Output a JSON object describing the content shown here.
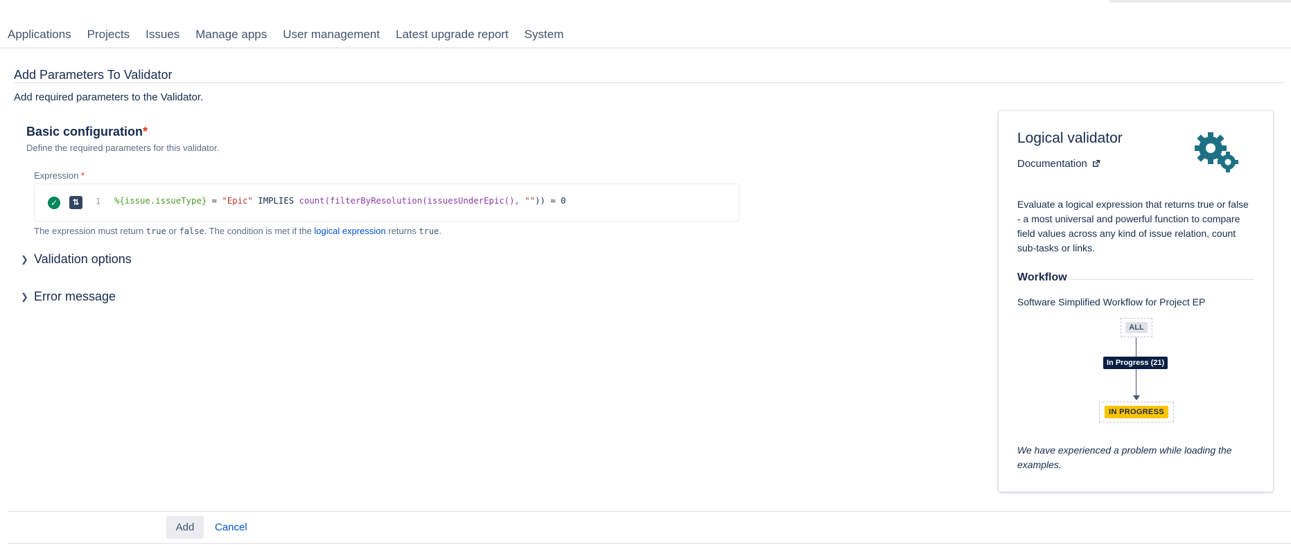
{
  "nav": {
    "items": [
      "Applications",
      "Projects",
      "Issues",
      "Manage apps",
      "User management",
      "Latest upgrade report",
      "System"
    ]
  },
  "page": {
    "title": "Add Parameters To Validator",
    "description": "Add required parameters to the Validator."
  },
  "basic": {
    "title": "Basic configuration",
    "required_mark": "*",
    "description": "Define the required parameters for this validator.",
    "expression_label": "Expression",
    "line_number": "1",
    "code_parts": [
      {
        "text": "%{issue.issueType}",
        "kind": "field"
      },
      {
        "text": " = ",
        "kind": "kw"
      },
      {
        "text": "\"Epic\"",
        "kind": "str"
      },
      {
        "text": " IMPLIES ",
        "kind": "kw"
      },
      {
        "text": "count(filterByResolution(issuesUnderEpic(), ",
        "kind": "fn"
      },
      {
        "text": "\"\"",
        "kind": "str"
      },
      {
        "text": ")) = 0",
        "kind": "kw"
      }
    ],
    "hint": {
      "p1": "The expression must return ",
      "code1": "true",
      "p2": " or ",
      "code2": "false",
      "p3": ". The condition is met if the ",
      "link": "logical expression",
      "p4": " returns ",
      "code3": "true",
      "p5": "."
    }
  },
  "collapsibles": {
    "validation": "Validation options",
    "error": "Error message"
  },
  "card": {
    "title": "Logical validator",
    "doc_link": "Documentation",
    "description": "Evaluate a logical expression that returns true or false - a most universal and powerful function to compare field values across any kind of issue relation, count sub-tasks or links.",
    "workflow_heading": "Workflow",
    "workflow_name": "Software Simplified Workflow for Project EP",
    "diagram": {
      "from": "ALL",
      "transition": "In Progress (21)",
      "to": "IN PROGRESS"
    },
    "error_text": "We have experienced a problem while loading the examples."
  },
  "footer": {
    "add": "Add",
    "cancel": "Cancel"
  },
  "colors": {
    "link": "#0052cc",
    "success": "#00875a",
    "status_in_progress": "#ffc400",
    "gear": "#1e7183"
  },
  "icons": [
    "check-circle-icon",
    "parser-icon",
    "external-link-icon",
    "chevron-right-icon",
    "gears-icon"
  ]
}
